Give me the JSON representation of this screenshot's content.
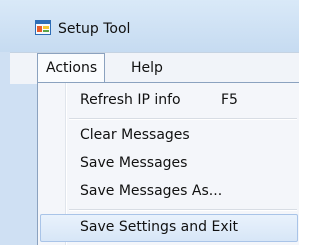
{
  "window": {
    "title": "Setup Tool",
    "icon": "app-window-icon"
  },
  "menubar": {
    "items": [
      {
        "label": "Actions",
        "state": "open"
      },
      {
        "label": "Help",
        "state": "normal"
      }
    ]
  },
  "dropdown": {
    "items": [
      {
        "label": "Refresh IP info",
        "shortcut": "F5"
      },
      {
        "label": "Clear Messages"
      },
      {
        "label": "Save Messages"
      },
      {
        "label": "Save Messages As..."
      },
      {
        "label": "Save Settings and Exit",
        "highlighted": true
      }
    ]
  },
  "colors": {
    "highlight": "#dbe9f8",
    "titlebar": "#c9ddf3",
    "menu_bg": "#f4f6fa"
  }
}
